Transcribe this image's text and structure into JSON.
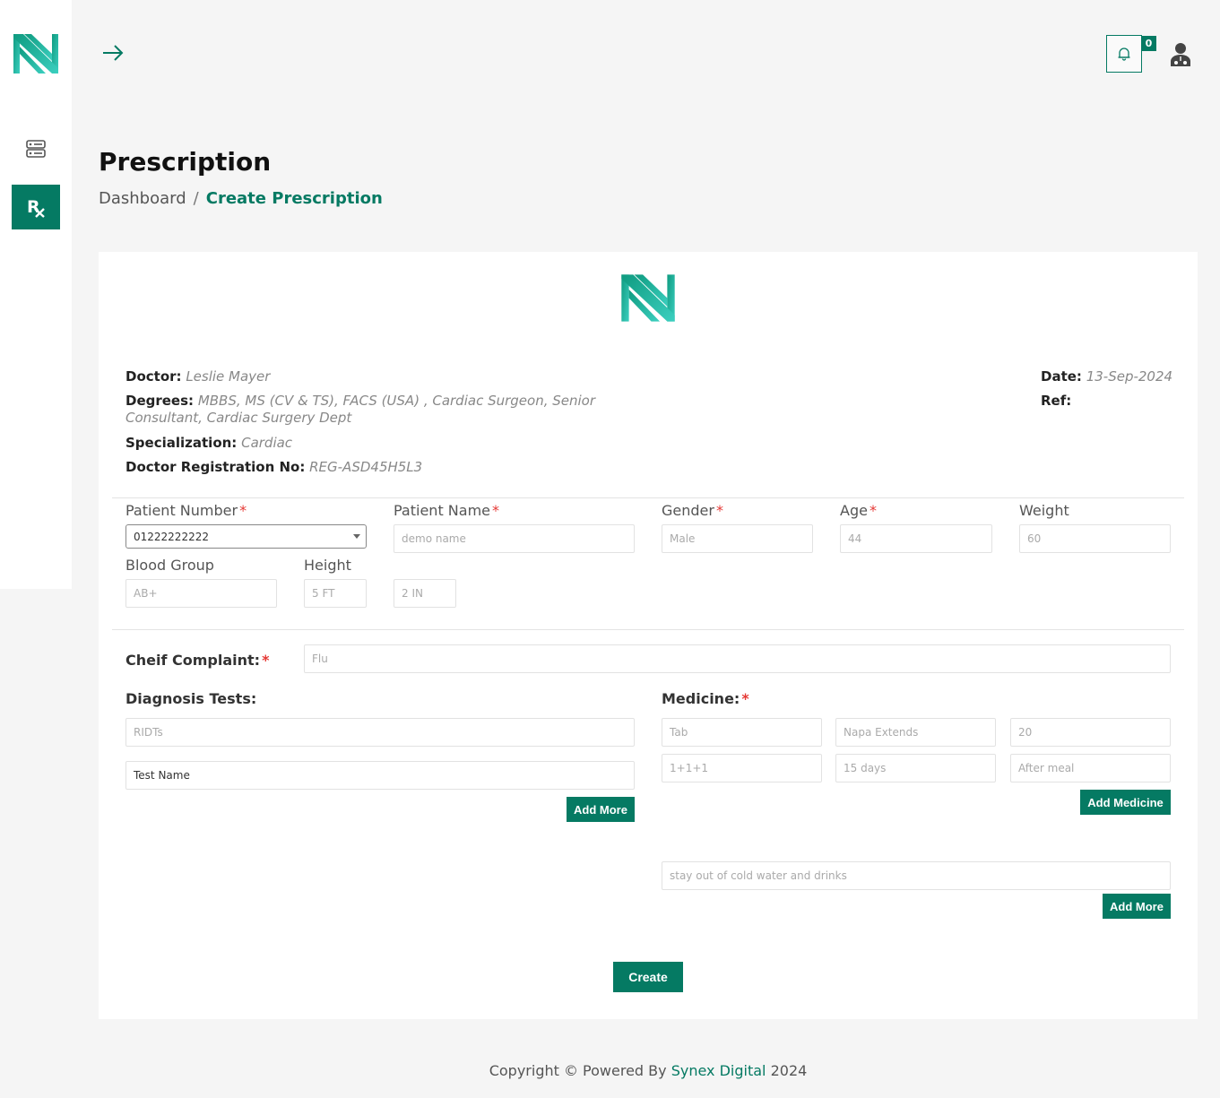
{
  "colors": {
    "accent": "#057a63",
    "logo_gradient": [
      "#0f9b80",
      "#3bcfbf"
    ],
    "required": "#e53935"
  },
  "sidebar": {
    "items": [
      {
        "icon": "list-icon",
        "active": false
      },
      {
        "icon": "rx-icon",
        "active": true
      }
    ]
  },
  "header": {
    "notifications_count": "0"
  },
  "page": {
    "title": "Prescription",
    "breadcrumb": {
      "home": "Dashboard",
      "separator": "/",
      "current": "Create Prescription"
    }
  },
  "doctor": {
    "name_label": "Doctor:",
    "name": "Leslie Mayer",
    "degrees_label": "Degrees:",
    "degrees_line1": "MBBS, MS (CV & TS), FACS (USA) , Cardiac Surgeon, Senior",
    "degrees_line2": "Consultant, Cardiac Surgery Dept",
    "specialization_label": "Specialization:",
    "specialization": "Cardiac",
    "reg_label": "Doctor Registration No:",
    "reg_no": "REG-ASD45H5L3",
    "date_label": "Date:",
    "date": "13-Sep-2024",
    "ref_label": "Ref:"
  },
  "patient": {
    "number_label": "Patient Number",
    "number_value": "01222222222",
    "name_label": "Patient Name",
    "name_value": "demo name",
    "gender_label": "Gender",
    "gender_value": "Male",
    "age_label": "Age",
    "age_value": "44",
    "weight_label": "Weight",
    "weight_value": "60",
    "blood_label": "Blood Group",
    "blood_value": "AB+",
    "height_label": "Height",
    "height_ft": "5 FT",
    "height_in": "2 IN",
    "required_mark": "*"
  },
  "complaint": {
    "label": "Cheif Complaint:",
    "value": "Flu"
  },
  "diagnosis": {
    "label": "Diagnosis Tests:",
    "test_value": "RIDTs",
    "test_placeholder": "Test Name",
    "add_more": "Add More"
  },
  "medicine": {
    "label": "Medicine:",
    "type": "Tab",
    "name": "Napa Extends",
    "qty": "20",
    "dose": "1+1+1",
    "duration": "15 days",
    "timing": "After meal",
    "add_medicine": "Add Medicine",
    "advice": "stay out of cold water and drinks",
    "add_more": "Add More"
  },
  "form": {
    "create": "Create"
  },
  "footer": {
    "prefix": "Copyright © Powered By",
    "brand": "Synex Digital",
    "year": "2024"
  }
}
